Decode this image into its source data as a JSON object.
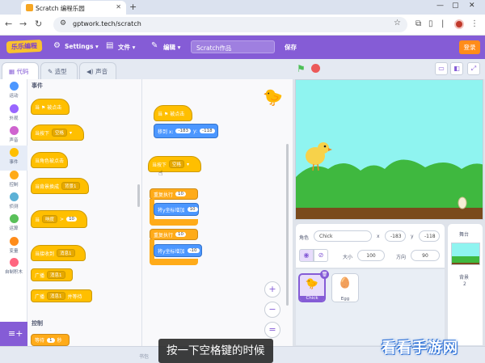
{
  "browser": {
    "tab_title": "Scratch 编程乐园",
    "new_tab": "+",
    "url": "gptwork.tech/scratch",
    "window_controls": [
      "—",
      "▢",
      "✕"
    ]
  },
  "menubar": {
    "logo_text": "乐乐编程",
    "settings": "Settings",
    "file": "文件",
    "edit": "编辑",
    "project_title": "Scratch作品",
    "save": "保存",
    "login": "登录"
  },
  "tabs": {
    "code": "代码",
    "costumes": "造型",
    "sounds": "声音"
  },
  "categories": [
    {
      "label": "运动",
      "color": "#4c97ff"
    },
    {
      "label": "外观",
      "color": "#9966ff"
    },
    {
      "label": "声音",
      "color": "#cf63cf"
    },
    {
      "label": "事件",
      "color": "#ffbf00"
    },
    {
      "label": "控制",
      "color": "#ffab19"
    },
    {
      "label": "侦测",
      "color": "#5cb1d6"
    },
    {
      "label": "运算",
      "color": "#59c059"
    },
    {
      "label": "变量",
      "color": "#ff8c1a"
    },
    {
      "label": "自制积木",
      "color": "#ff6680"
    }
  ],
  "palette": {
    "events_title": "事件",
    "control_title": "控制",
    "when_flag": "当 ⚑ 被点击",
    "when_key": "当按下",
    "key_value": "空格",
    "when_sprite_clicked": "当角色被点击",
    "when_backdrop": "当背景换成",
    "backdrop_value": "背景1",
    "when_loudness": "当",
    "loudness_opt": "响度",
    "loudness_val": "10",
    "when_receive": "当接收到",
    "message_value": "消息1",
    "broadcast": "广播",
    "broadcast_wait": "广播",
    "broadcast_wait_suffix": "并等待",
    "wait": "等待",
    "wait_val": "1",
    "wait_unit": "秒"
  },
  "script": {
    "hat1": "当 ⚑ 被点击",
    "goto": "移到 x:",
    "x_val": "-183",
    "y_label": "y:",
    "y_val": "-118",
    "hat2": "当按下",
    "key2": "空格",
    "repeat1": "重复执行",
    "repeat1_val": "10",
    "change_y1": "将y坐标增加",
    "change_y1_val": "10",
    "repeat2": "重复执行",
    "repeat2_val": "10",
    "change_y2": "将y坐标增加",
    "change_y2_val": "-10",
    "zoom_in": "+",
    "zoom_out": "−",
    "zoom_reset": "="
  },
  "sprite_info": {
    "sprite_label": "角色",
    "sprite_name": "Chick",
    "x_label": "x",
    "x_val": "-183",
    "y_label": "y",
    "y_val": "-118",
    "show_label": "显示",
    "size_label": "大小",
    "size_val": "100",
    "direction_label": "方向",
    "direction_val": "90"
  },
  "sprites": [
    {
      "name": "Chick",
      "icon": "🐤",
      "selected": true
    },
    {
      "name": "Egg",
      "icon": "🥚",
      "selected": false
    }
  ],
  "stage_panel": {
    "title": "舞台",
    "backdrop_label": "背景",
    "backdrop_count": "2"
  },
  "backpack": "书包",
  "subtitle": "按一下空格键的时候",
  "watermark": "看看手游网"
}
